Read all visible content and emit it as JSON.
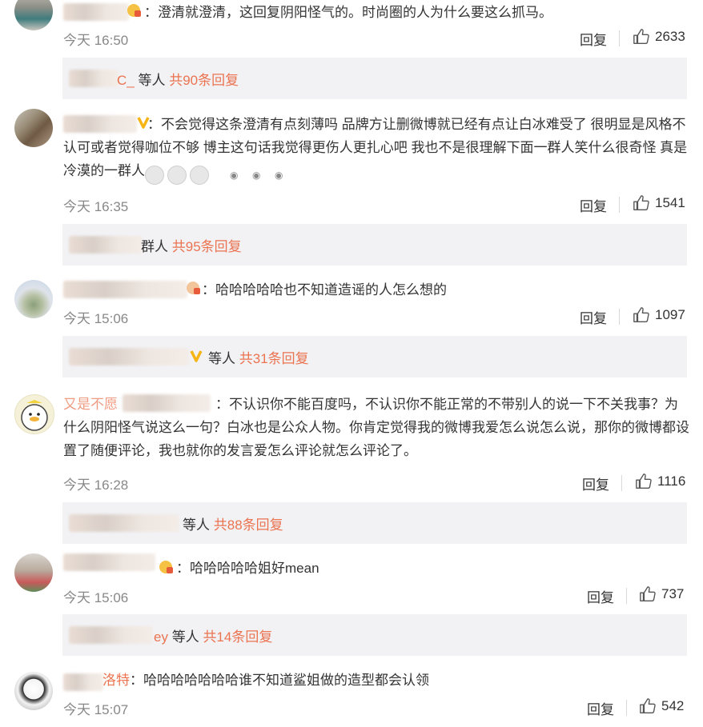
{
  "comments": [
    {
      "text": "：澄清就澄清，这回复阴阳怪气的。时尚圈的人为什么要这么抓马。",
      "time": "今天 16:50",
      "reply": "回复",
      "likes": "2633",
      "sub": {
        "tail": "C_",
        "prefix": "等人",
        "count": "共90条回复"
      }
    },
    {
      "text": "：不会觉得这条澄清有点刻薄吗 品牌方让删微博就已经有点让白冰难受了 很明显是风格不认可或者觉得咖位不够 博主这句话我觉得更伤人更扎心吧 我也不是很理解下面一群人笑什么很奇怪 真是冷漠的一群人",
      "time": "今天 16:35",
      "reply": "回复",
      "likes": "1541",
      "sub": {
        "tail": "群人",
        "prefix": "",
        "count": "共95条回复"
      }
    },
    {
      "text": "：哈哈哈哈哈也不知道造谣的人怎么想的",
      "time": "今天 15:06",
      "reply": "回复",
      "likes": "1097",
      "sub": {
        "tail": "",
        "prefix": "等人",
        "count": "共31条回复"
      }
    },
    {
      "name_tail": "又是不愿",
      "text": "：不认识你不能百度吗，不认识你不能正常的不带别人的说一下不关我事？为什么阴阳怪气说这么一句？白冰也是公众人物。你肯定觉得我的微博我爱怎么说怎么说，那你的微博都设置了随便评论，我也就你的发言爱怎么评论就怎么评论了。",
      "time": "今天 16:28",
      "reply": "回复",
      "likes": "1116",
      "sub": {
        "tail": "",
        "prefix": "等人",
        "count": "共88条回复"
      }
    },
    {
      "text": "：哈哈哈哈哈姐好mean",
      "time": "今天 15:06",
      "reply": "回复",
      "likes": "737",
      "sub": {
        "tail": "ey",
        "prefix": "等人",
        "count": "共14条回复"
      }
    },
    {
      "name_tail": "洛特",
      "text": "：哈哈哈哈哈哈哈谁不知道鲨姐做的造型都会认领",
      "time": "今天 15:07",
      "reply": "回复",
      "likes": "542"
    }
  ],
  "colors": {
    "accent": "#eb7350",
    "meta": "#888888",
    "subbox": "#f2f2f5"
  },
  "icons": {
    "like": "thumbs-up-icon",
    "vip": "vip-badge-icon",
    "emoji": "crying-emoji-icon"
  }
}
